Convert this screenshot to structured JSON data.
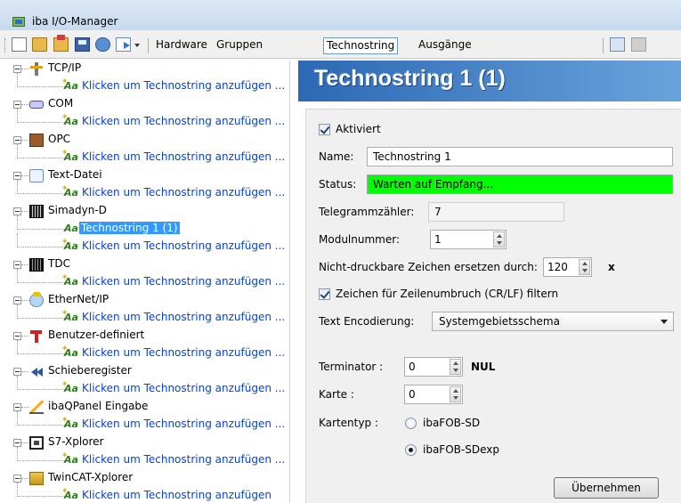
{
  "window": {
    "title": "iba I/O-Manager"
  },
  "toolbar": {
    "hardware": "Hardware",
    "gruppen": "Gruppen",
    "technostring": "Technostring",
    "ausgaenge": "Ausgänge"
  },
  "tree": {
    "groups": [
      {
        "label": "TCP/IP",
        "icon": "network-plug-icon",
        "children": [
          "Klicken um Technostring anzufügen ..."
        ]
      },
      {
        "label": "COM",
        "icon": "serial-port-icon",
        "children": [
          "Klicken um Technostring anzufügen ..."
        ]
      },
      {
        "label": "OPC",
        "icon": "opc-icon",
        "children": [
          "Klicken um Technostring anzufügen ..."
        ]
      },
      {
        "label": "Text-Datei",
        "icon": "text-file-icon",
        "children": [
          "Klicken um Technostring anzufügen ..."
        ]
      },
      {
        "label": "Simadyn-D",
        "icon": "simadyn-rack-icon",
        "children": [
          "Technostring 1 (1)",
          "Klicken um Technostring anzufügen ..."
        ]
      },
      {
        "label": "TDC",
        "icon": "tdc-rack-icon",
        "children": [
          "Klicken um Technostring anzufügen ..."
        ]
      },
      {
        "label": "EtherNet/IP",
        "icon": "ethernet-ip-icon",
        "children": [
          "Klicken um Technostring anzufügen ..."
        ]
      },
      {
        "label": "Benutzer-definiert",
        "icon": "user-defined-icon",
        "children": [
          "Klicken um Technostring anzufügen ..."
        ]
      },
      {
        "label": "Schieberegister",
        "icon": "shift-register-icon",
        "children": [
          "Klicken um Technostring anzufügen ..."
        ]
      },
      {
        "label": "ibaQPanel Eingabe",
        "icon": "qpanel-icon",
        "children": [
          "Klicken um Technostring anzufügen ..."
        ]
      },
      {
        "label": "S7-Xplorer",
        "icon": "s7-xplorer-icon",
        "children": [
          "Klicken um Technostring anzufügen ..."
        ]
      },
      {
        "label": "TwinCAT-Xplorer",
        "icon": "twincat-icon",
        "children": [
          "Klicken um Technostring anzufügen"
        ]
      }
    ],
    "selected": "Technostring 1 (1)"
  },
  "panel": {
    "title": "Technostring 1 (1)",
    "aktiviert_label": "Aktiviert",
    "aktiviert_checked": true,
    "name_label": "Name:",
    "name_value": "Technostring 1",
    "status_label": "Status:",
    "status_value": "Warten auf Empfang...",
    "status_color": "#00ff00",
    "telegramm_label": "Telegrammzähler:",
    "telegramm_value": "7",
    "modul_label": "Modulnummer:",
    "modul_value": "1",
    "nicht_label": "Nicht-druckbare Zeichen ersetzen durch:",
    "nicht_value": "120",
    "nicht_char": "x",
    "zeilen_label": "Zeichen für Zeilenumbruch (CR/LF) filtern",
    "zeilen_checked": true,
    "encoding_label": "Text Encodierung:",
    "encoding_value": "Systemgebietsschema",
    "terminator_label": "Terminator :",
    "terminator_value": "0",
    "terminator_name": "NUL",
    "karte_label": "Karte :",
    "karte_value": "0",
    "kartentyp_label": "Kartentyp :",
    "kartentyp_options": [
      "ibaFOB-SD",
      "ibaFOB-SDexp"
    ],
    "kartentyp_selected": "ibaFOB-SDexp",
    "apply_label": "Übernehmen"
  }
}
